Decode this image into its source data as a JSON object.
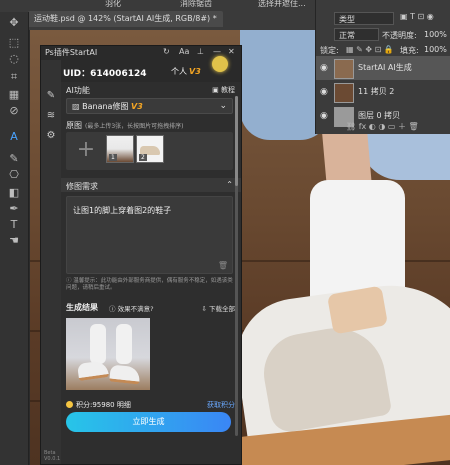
{
  "photoshop": {
    "doc_tab": "运动鞋.psd @ 142% (StartAI AI生成, RGB/8#) *",
    "top_hints": [
      "羽化",
      "消除锯齿",
      "选择并遮住..."
    ],
    "layers": {
      "kind": "类型",
      "blend_mode": "正常",
      "opacity_label": "不透明度:",
      "opacity_value": "100%",
      "lock_label": "锁定:",
      "fill_label": "填充:",
      "fill_value": "100%",
      "items": [
        {
          "name": "StartAI AI生成",
          "active": true
        },
        {
          "name": "11 拷贝 2",
          "active": false
        },
        {
          "name": "图层 0 拷贝",
          "active": false
        }
      ]
    }
  },
  "plugin": {
    "title": "Ps插件StartAI",
    "uid": "UID：614006124",
    "account": "个人",
    "vip": "V3",
    "ai_function_label": "AI功能",
    "tutorial": "教程",
    "model": "Banana修图",
    "model_version": "V3",
    "ref_label": "原图",
    "ref_hint": "(最多上传3张，长按图片可拖拽排序)",
    "ref_numbers": [
      "1",
      "2"
    ],
    "requirement_label": "修图需求",
    "requirement_text": "让图1的脚上穿着图2的鞋子",
    "warning": "温馨提示：此功能由外部服务商提供，偶有服务不稳定，如遇该类问题，请稍后重试。",
    "result_label": "生成结果",
    "result_hint": "效果不满意?",
    "download_all": "下载全部",
    "credits": "积分:95980",
    "detail": "明细",
    "get_credits": "获取积分",
    "generate_button": "立即生成",
    "beta": "Beta V0.0.1"
  }
}
